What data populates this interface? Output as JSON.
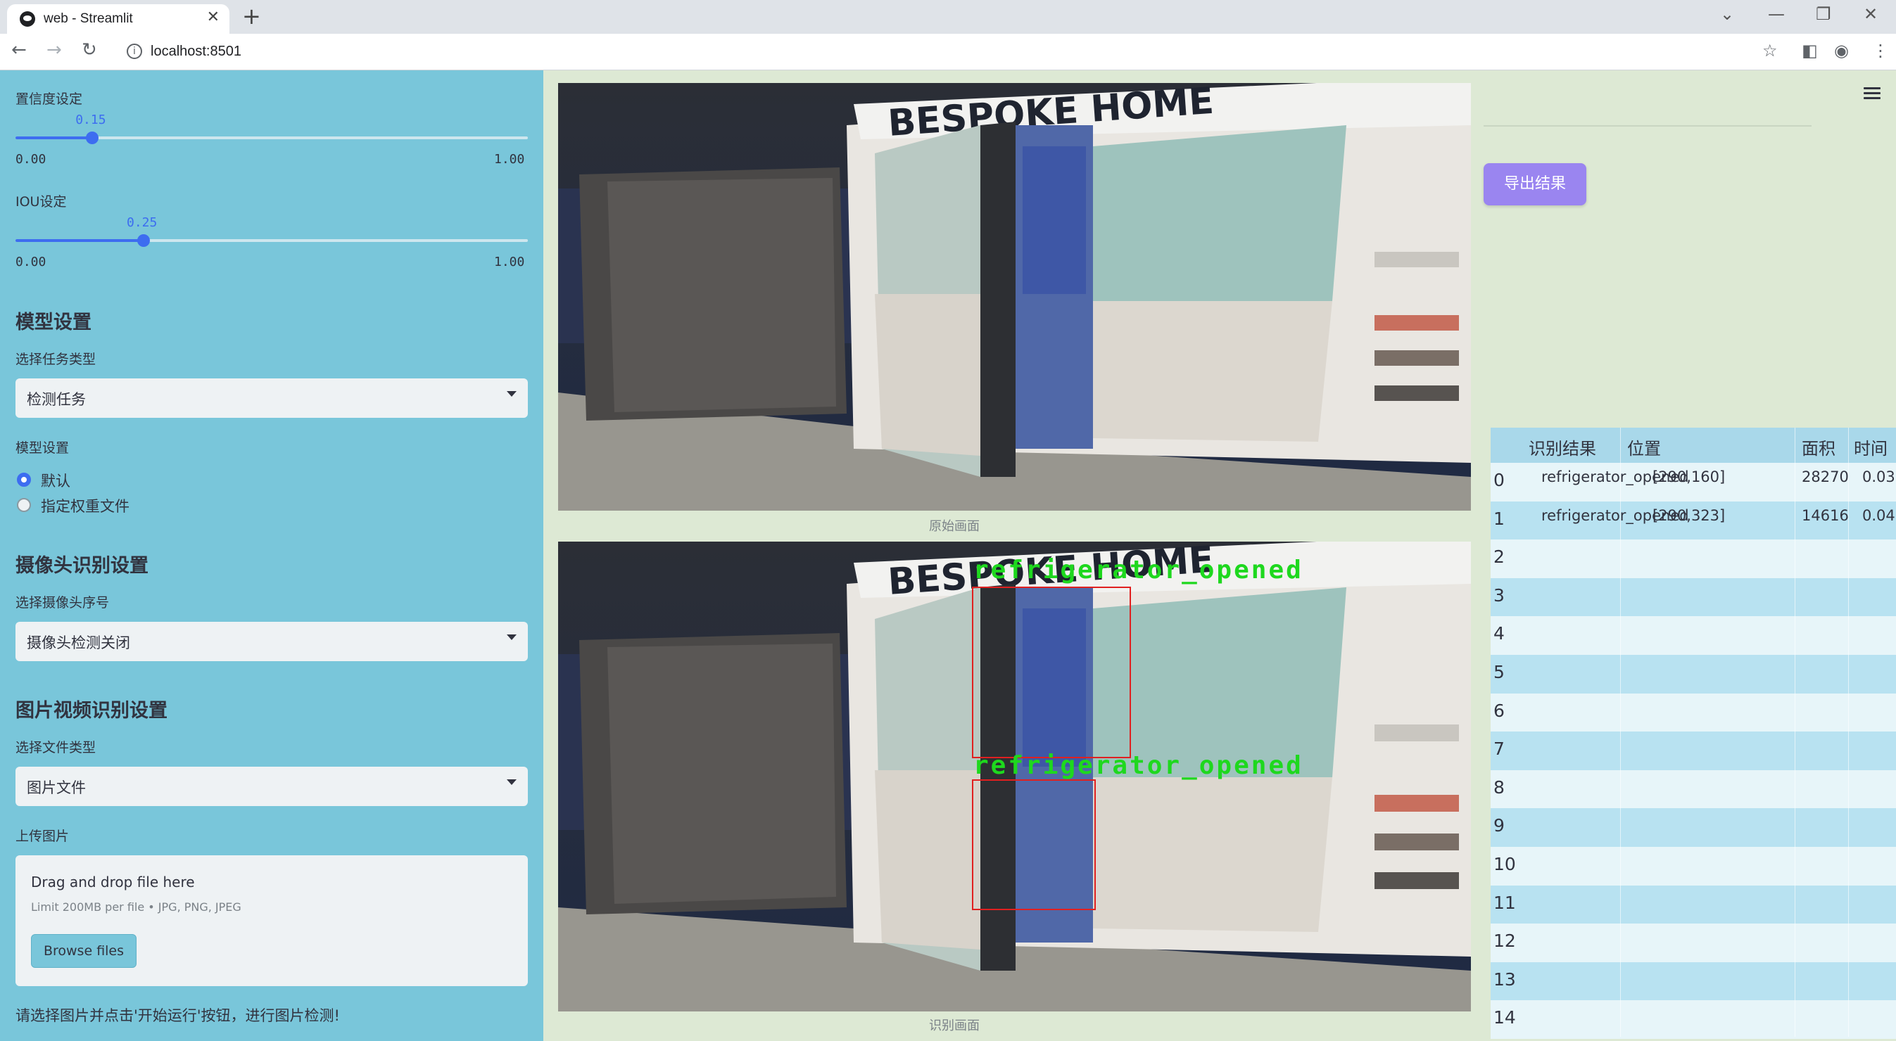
{
  "browser": {
    "tab_title": "web - Streamlit",
    "url": "localhost:8501"
  },
  "sidebar": {
    "confidence": {
      "label": "置信度设定",
      "value": "0.15",
      "min": "0.00",
      "max": "1.00",
      "fraction": 0.15
    },
    "iou": {
      "label": "IOU设定",
      "value": "0.25",
      "min": "0.00",
      "max": "1.00",
      "fraction": 0.25
    },
    "model_section": {
      "heading": "模型设置",
      "task_label": "选择任务类型",
      "task_value": "检测任务",
      "model_label": "模型设置",
      "options": [
        "默认",
        "指定权重文件"
      ],
      "selected": 0
    },
    "camera_section": {
      "heading": "摄像头识别设置",
      "camera_label": "选择摄像头序号",
      "camera_value": "摄像头检测关闭"
    },
    "file_section": {
      "heading": "图片视频识别设置",
      "type_label": "选择文件类型",
      "type_value": "图片文件",
      "upload_label": "上传图片",
      "drop_text": "Drag and drop file here",
      "limit_text": "Limit 200MB per file • JPG, PNG, JPEG",
      "browse_label": "Browse files"
    },
    "hint": "请选择图片并点击'开始运行'按钮，进行图片检测!"
  },
  "images": {
    "original_caption": "原始画面",
    "result_caption": "识别画面",
    "sign_text": "BESPOKE HOME",
    "detections": [
      "refrigerator_opened",
      "refrigerator_opened"
    ]
  },
  "right": {
    "export_label": "导出结果",
    "table": {
      "headers": [
        "识别结果",
        "位置",
        "面积",
        "时间"
      ],
      "rows": [
        {
          "index": "0",
          "result": "refrigerator_opened",
          "position": "[290,160]",
          "area": "28270",
          "time": "0.03"
        },
        {
          "index": "1",
          "result": "refrigerator_opened",
          "position": "[290,323]",
          "area": "14616",
          "time": "0.04"
        },
        {
          "index": "2"
        },
        {
          "index": "3"
        },
        {
          "index": "4"
        },
        {
          "index": "5"
        },
        {
          "index": "6"
        },
        {
          "index": "7"
        },
        {
          "index": "8"
        },
        {
          "index": "9"
        },
        {
          "index": "10"
        },
        {
          "index": "11"
        },
        {
          "index": "12"
        },
        {
          "index": "13"
        },
        {
          "index": "14"
        }
      ]
    }
  }
}
